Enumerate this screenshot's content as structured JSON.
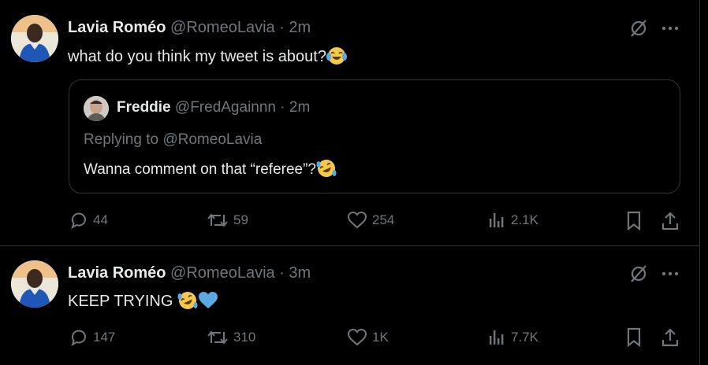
{
  "tweets": [
    {
      "name": "Lavia Roméo",
      "handle": "@RomeoLavia",
      "time": "· 2m",
      "text": "what do you think my tweet is about?",
      "emojis": [
        "joy-emoji"
      ],
      "quote": {
        "name": "Freddie",
        "handle": "@FredAgainnn",
        "time": "· 2m",
        "replying_prefix": "Replying to ",
        "replying_handle": "@RomeoLavia",
        "text": "Wanna comment on that “referee”?",
        "emojis": [
          "rofl-emoji"
        ]
      },
      "actions": {
        "replies": "44",
        "reposts": "59",
        "likes": "254",
        "views": "2.1K"
      }
    },
    {
      "name": "Lavia Roméo",
      "handle": "@RomeoLavia",
      "time": "· 3m",
      "text": "KEEP TRYING ",
      "emojis": [
        "rofl-emoji",
        "blue-heart-emoji"
      ],
      "actions": {
        "replies": "147",
        "reposts": "310",
        "likes": "1K",
        "views": "7.7K"
      }
    }
  ],
  "colors": {
    "background": "#000000",
    "text": "#e7e9ea",
    "muted": "#71767b",
    "border": "#2f3336",
    "heart_blue": "#5aa9e6",
    "emoji_yellow": "#f7c948"
  }
}
